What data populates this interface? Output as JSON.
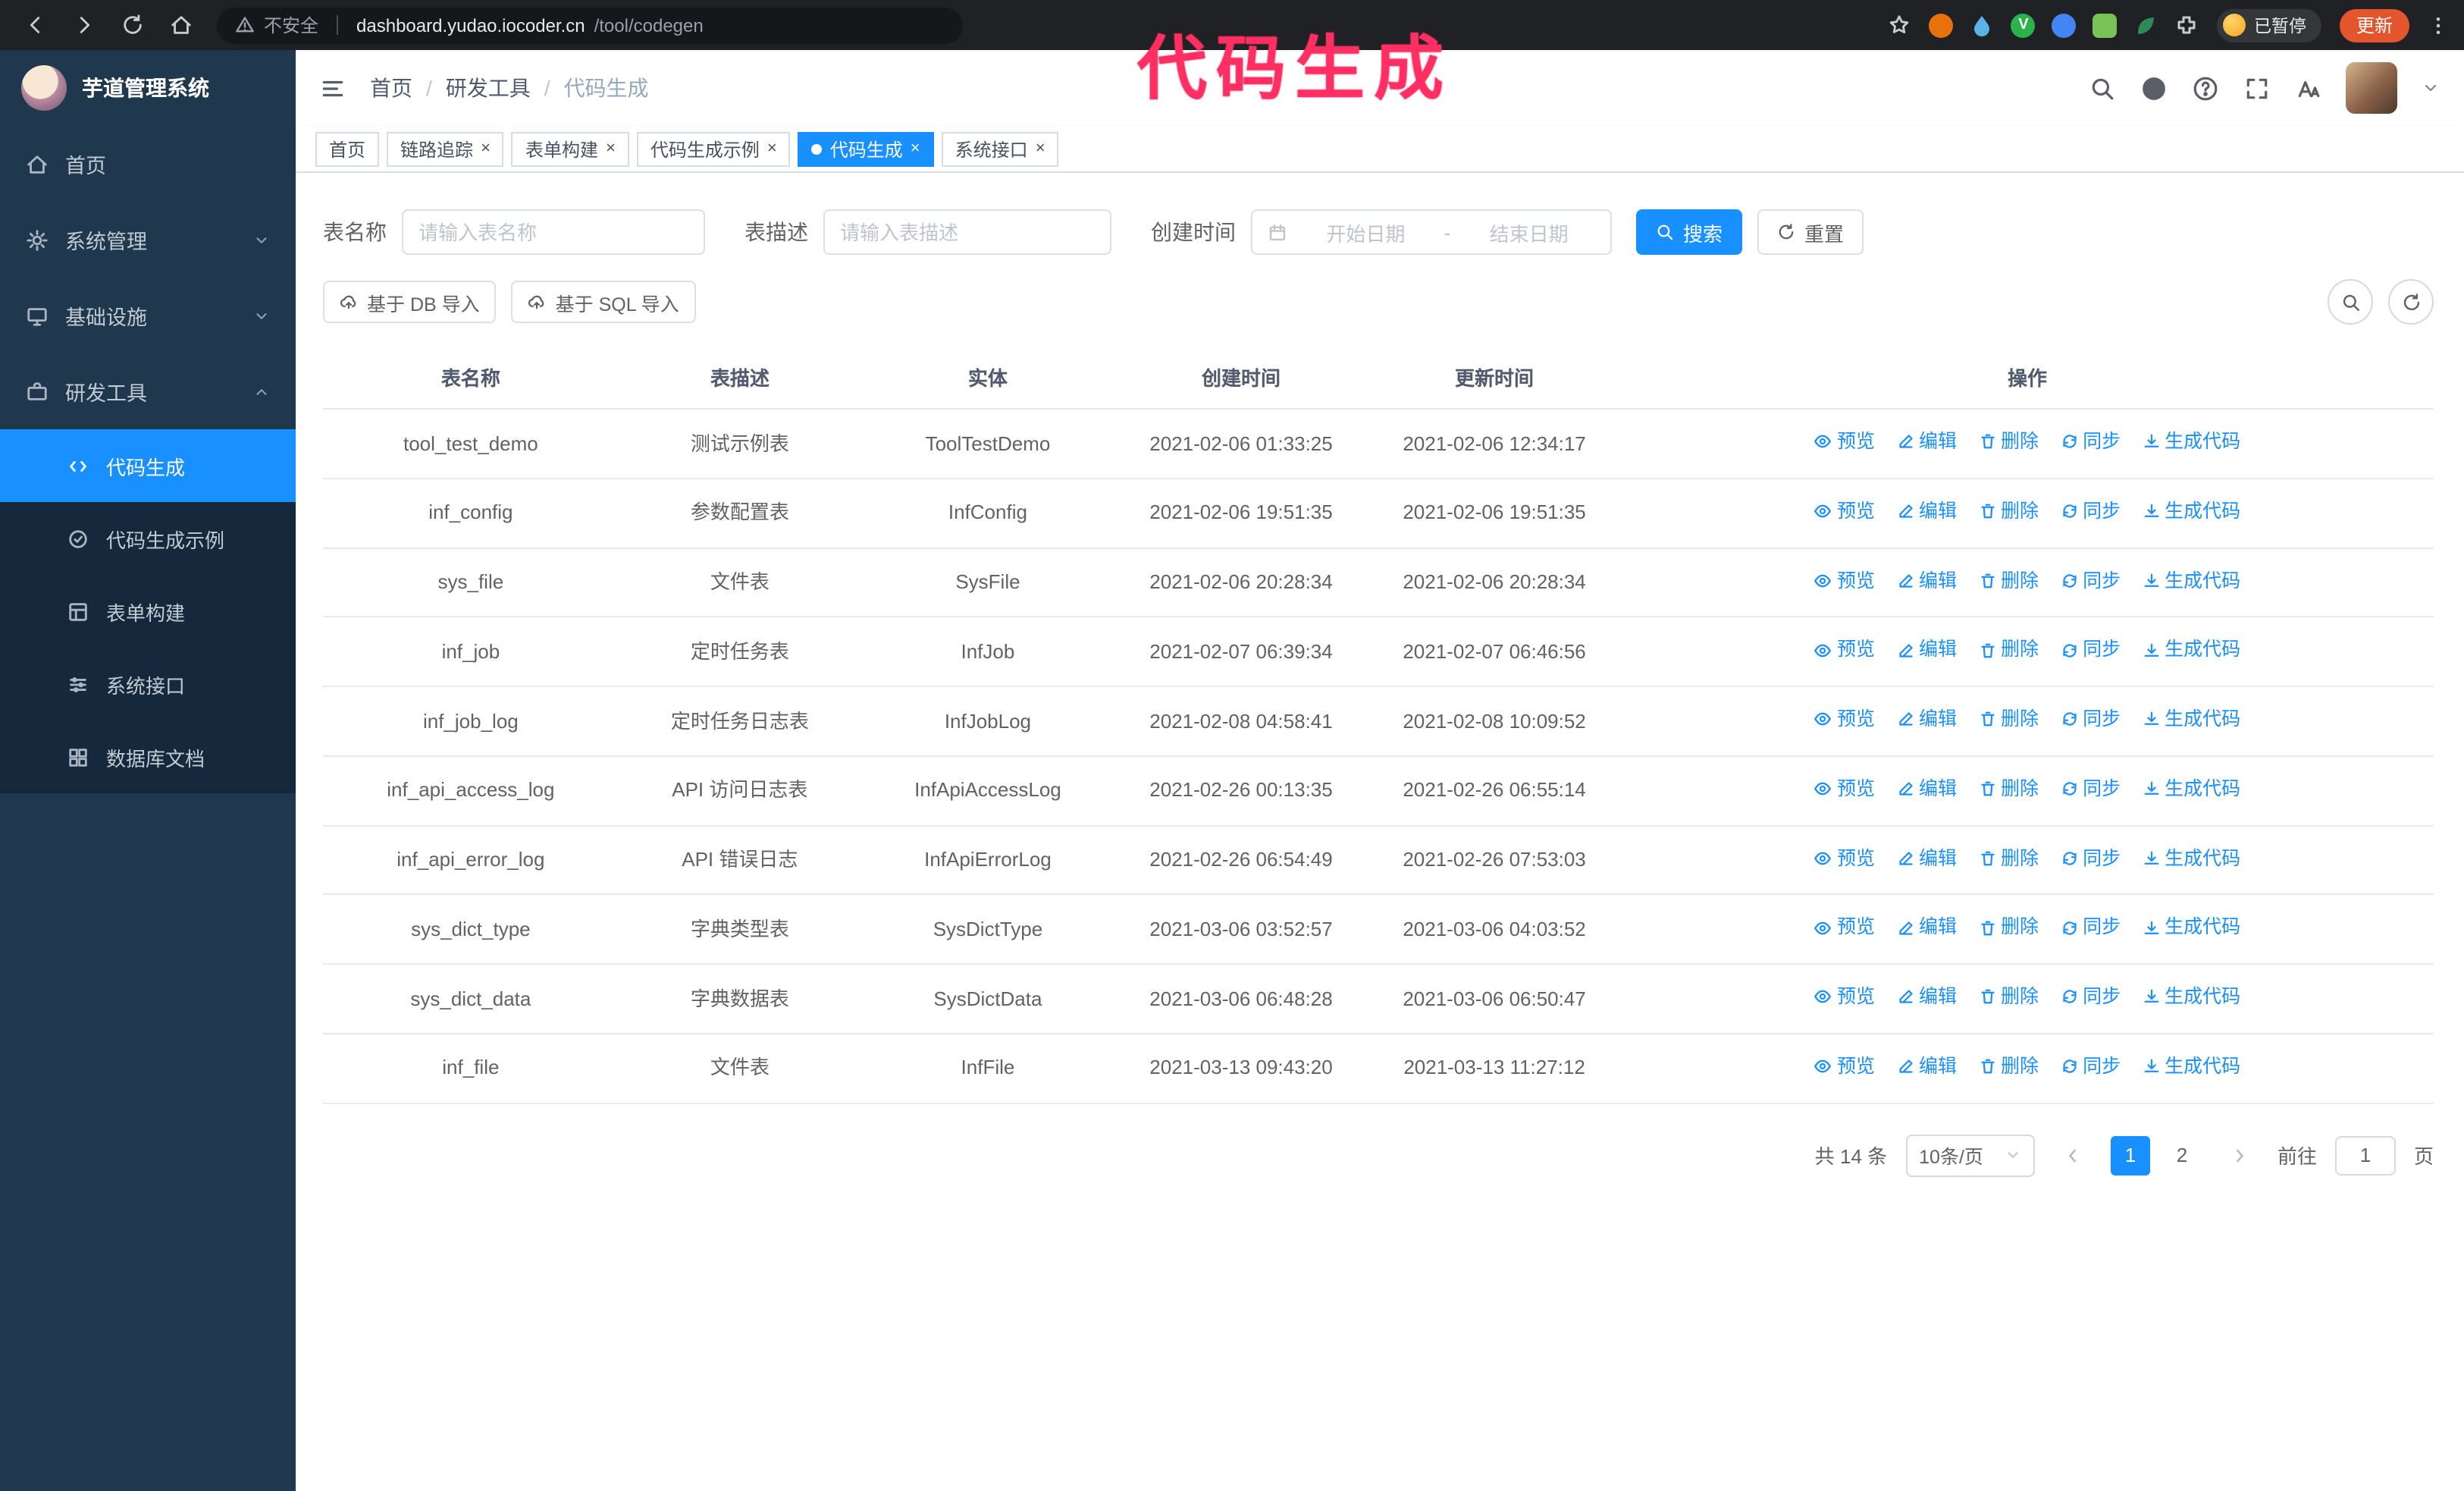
{
  "colors": {
    "accent": "#1890ff",
    "annotation": "#ff2e63",
    "update_button": "#e2552d",
    "sidebar_bg": "#20384e",
    "submenu_bg": "#16293c"
  },
  "annotation": {
    "text": "代码生成"
  },
  "browser": {
    "security_text": "不安全",
    "url_host": "dashboard.yudao.iocoder.cn",
    "url_path": "/tool/codegen",
    "paused_badge": "已暂停",
    "update_label": "更新",
    "extensions": [
      {
        "shape": "circle",
        "color": "#e8710a"
      },
      {
        "shape": "drop",
        "color": "#59b3e8"
      },
      {
        "shape": "v-circle",
        "color": "#2bb24c"
      },
      {
        "shape": "circle",
        "color": "#4285f4"
      },
      {
        "shape": "square",
        "color": "#79c257"
      },
      {
        "shape": "leaf",
        "color": "#2e8b57"
      },
      {
        "shape": "puzzle",
        "color": "#c9cccf"
      }
    ]
  },
  "sidebar": {
    "logo_title": "芋道管理系统",
    "menu": [
      {
        "label": "首页",
        "icon": "home"
      },
      {
        "label": "系统管理",
        "icon": "gear",
        "chevron": "down"
      },
      {
        "label": "基础设施",
        "icon": "infra",
        "chevron": "down"
      },
      {
        "label": "研发工具",
        "icon": "tools",
        "chevron": "up",
        "open": true
      }
    ],
    "submenu": [
      {
        "label": "代码生成",
        "icon": "code",
        "active": true,
        "name": "codegen"
      },
      {
        "label": "代码生成示例",
        "icon": "badge",
        "name": "codegen-example"
      },
      {
        "label": "表单构建",
        "icon": "form",
        "name": "form-builder"
      },
      {
        "label": "系统接口",
        "icon": "api",
        "name": "system-api"
      },
      {
        "label": "数据库文档",
        "icon": "db",
        "name": "db-doc"
      }
    ]
  },
  "header": {
    "breadcrumb": [
      "首页",
      "研发工具",
      "代码生成"
    ],
    "icons": [
      {
        "name": "search",
        "icon": "search"
      },
      {
        "name": "github",
        "icon": "github"
      },
      {
        "name": "help",
        "icon": "question"
      },
      {
        "name": "fullscreen",
        "icon": "full"
      },
      {
        "name": "font-size",
        "icon": "font"
      }
    ]
  },
  "tabs": [
    {
      "label": "首页",
      "closable": false
    },
    {
      "label": "链路追踪",
      "closable": true
    },
    {
      "label": "表单构建",
      "closable": true
    },
    {
      "label": "代码生成示例",
      "closable": true
    },
    {
      "label": "代码生成",
      "closable": true,
      "active": true
    },
    {
      "label": "系统接口",
      "closable": true
    }
  ],
  "filters": {
    "name_label": "表名称",
    "name_placeholder": "请输入表名称",
    "desc_label": "表描述",
    "desc_placeholder": "请输入表描述",
    "time_label": "创建时间",
    "date_start": "开始日期",
    "date_sep": "-",
    "date_end": "结束日期",
    "search": "搜索",
    "reset": "重置"
  },
  "toolbar": {
    "import_db": "基于 DB 导入",
    "import_sql": "基于 SQL 导入"
  },
  "table": {
    "columns": [
      "表名称",
      "表描述",
      "实体",
      "创建时间",
      "更新时间",
      "操作"
    ],
    "row_actions": [
      {
        "label": "预览",
        "icon": "eye",
        "name": "preview"
      },
      {
        "label": "编辑",
        "icon": "edit",
        "name": "edit"
      },
      {
        "label": "删除",
        "icon": "del",
        "name": "delete"
      },
      {
        "label": "同步",
        "icon": "sync",
        "name": "sync"
      },
      {
        "label": "生成代码",
        "icon": "gen",
        "name": "generate-code"
      }
    ],
    "rows": [
      {
        "name": "tool_test_demo",
        "desc": "测试示例表",
        "entity": "ToolTestDemo",
        "created": "2021-02-06 01:33:25",
        "updated": "2021-02-06 12:34:17"
      },
      {
        "name": "inf_config",
        "desc": "参数配置表",
        "entity": "InfConfig",
        "created": "2021-02-06 19:51:35",
        "updated": "2021-02-06 19:51:35"
      },
      {
        "name": "sys_file",
        "desc": "文件表",
        "entity": "SysFile",
        "created": "2021-02-06 20:28:34",
        "updated": "2021-02-06 20:28:34"
      },
      {
        "name": "inf_job",
        "desc": "定时任务表",
        "entity": "InfJob",
        "created": "2021-02-07 06:39:34",
        "updated": "2021-02-07 06:46:56"
      },
      {
        "name": "inf_job_log",
        "desc": "定时任务日志表",
        "entity": "InfJobLog",
        "created": "2021-02-08 04:58:41",
        "updated": "2021-02-08 10:09:52"
      },
      {
        "name": "inf_api_access_log",
        "desc": "API 访问日志表",
        "entity": "InfApiAccessLog",
        "created": "2021-02-26 00:13:35",
        "updated": "2021-02-26 06:55:14"
      },
      {
        "name": "inf_api_error_log",
        "desc": "API 错误日志",
        "entity": "InfApiErrorLog",
        "created": "2021-02-26 06:54:49",
        "updated": "2021-02-26 07:53:03"
      },
      {
        "name": "sys_dict_type",
        "desc": "字典类型表",
        "entity": "SysDictType",
        "created": "2021-03-06 03:52:57",
        "updated": "2021-03-06 04:03:52"
      },
      {
        "name": "sys_dict_data",
        "desc": "字典数据表",
        "entity": "SysDictData",
        "created": "2021-03-06 06:48:28",
        "updated": "2021-03-06 06:50:47"
      },
      {
        "name": "inf_file",
        "desc": "文件表",
        "entity": "InfFile",
        "created": "2021-03-13 09:43:20",
        "updated": "2021-03-13 11:27:12"
      }
    ]
  },
  "pagination": {
    "total": "共 14 条",
    "page_size": "10条/页",
    "pages": [
      "1",
      "2"
    ],
    "active": "1",
    "goto_prefix": "前往",
    "goto_value": "1",
    "goto_suffix": "页"
  }
}
